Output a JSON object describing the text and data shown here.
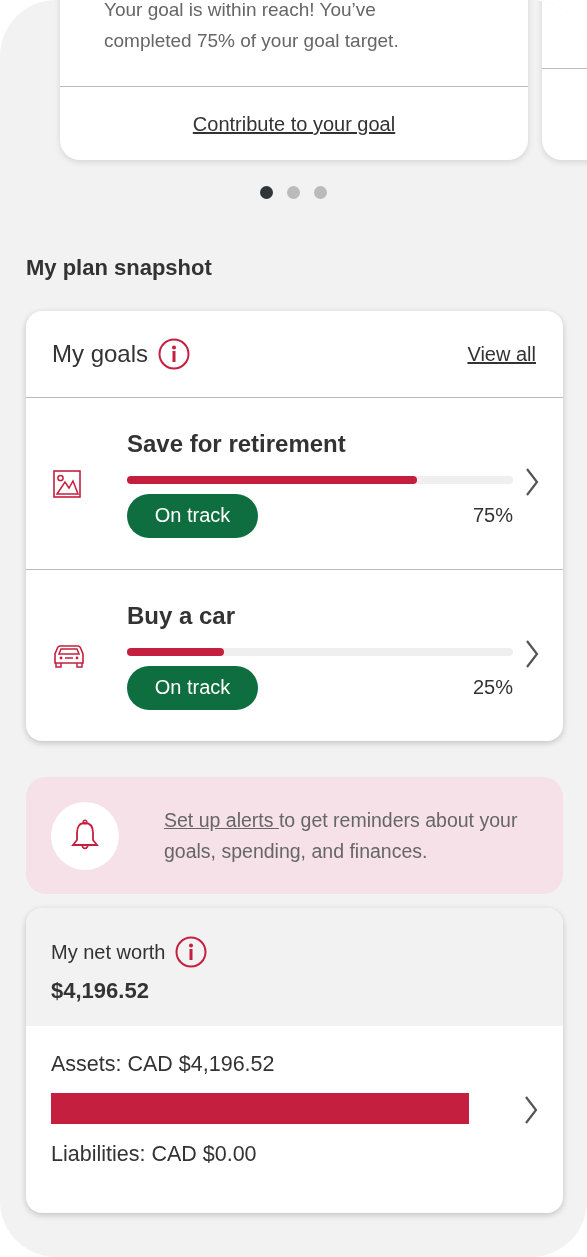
{
  "carousel": {
    "cards": [
      {
        "message": "Your goal is within reach! You’ve completed 75% of your goal target.",
        "link": "Contribute to your goal"
      }
    ],
    "dots": [
      {
        "selected": true
      },
      {
        "selected": false
      },
      {
        "selected": false
      }
    ]
  },
  "section_title": "My plan snapshot",
  "goals": {
    "title": "My goals",
    "view_all": "View all",
    "items": [
      {
        "kind": "picture",
        "name": "Save for retirement",
        "level": 0.75,
        "status": "On track",
        "percent": "75%"
      },
      {
        "kind": "car",
        "name": "Buy a car",
        "level": 0.25,
        "status": "On track",
        "percent": "25%"
      }
    ]
  },
  "alert": {
    "link": "Set up alerts ",
    "text": "to get reminders about your goals, spending, and finances."
  },
  "net_worth": {
    "title": "My net worth",
    "amount": "$4,196.52",
    "assets": "Assets: CAD $4,196.52",
    "liabilities": "Liabilities: CAD $0.00"
  }
}
